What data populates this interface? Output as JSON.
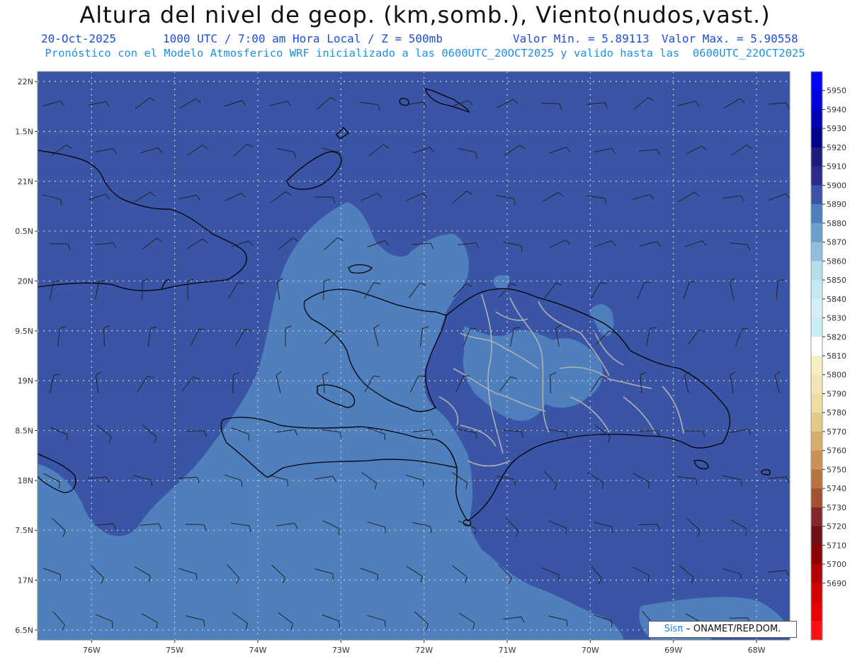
{
  "title": "Altura del nivel de geop. (km,somb.), Viento(nudos,vast.)",
  "subtitle": {
    "date": "20-Oct-2025",
    "time": "1000 UTC / 7:00 am Hora Local / Z = 500mb",
    "min": "Valor Min. = 5.89113",
    "max": "Valor Max. = 5.90558"
  },
  "forecast_note": "Pronóstico con el Modelo Atmosferico WRF inicializado a las 0600UTC_20OCT2025 y valido hasta las  0600UTC_22OCT2025",
  "credit": {
    "brand": "Sisπ",
    "text": " – ONAMET/REP.DOM."
  },
  "chart_data": {
    "type": "heatmap",
    "variable": "500mb geopotential height (m) with wind barbs (knots)",
    "lat_labels": [
      "22N",
      "1.5N",
      "21N",
      "0.5N",
      "20N",
      "9.5N",
      "19N",
      "8.5N",
      "18N",
      "7.5N",
      "17N",
      "6.5N"
    ],
    "lat_values": [
      22,
      21.5,
      21,
      20.5,
      20,
      19.5,
      19,
      18.5,
      18,
      17.5,
      17,
      16.5
    ],
    "lon_labels": [
      "76W",
      "75W",
      "74W",
      "73W",
      "72W",
      "71W",
      "70W",
      "69W",
      "68W"
    ],
    "lon_values": [
      -76,
      -75,
      -74,
      -73,
      -72,
      -71,
      -70,
      -69,
      -68
    ],
    "xlim": [
      -76.65,
      -67.6
    ],
    "ylim": [
      16.4,
      22.1
    ],
    "value_range": [
      5891.13,
      5905.58
    ],
    "grid": true,
    "colorbar": {
      "labels": [
        5950,
        5940,
        5930,
        5920,
        5910,
        5900,
        5890,
        5880,
        5870,
        5860,
        5850,
        5840,
        5830,
        5820,
        5810,
        5800,
        5790,
        5780,
        5770,
        5760,
        5750,
        5740,
        5730,
        5720,
        5710,
        5700,
        5690
      ],
      "colors": [
        "#0000ff",
        "#0000dd",
        "#0000b4",
        "#00008b",
        "#1c1c7c",
        "#2a2a8c",
        "#3a55a6",
        "#4f80bd",
        "#6b9fcc",
        "#92bedd",
        "#b4dcea",
        "#c6e8f0",
        "#d4eef7",
        "#c8eef5",
        "#ffffff",
        "#f6efc4",
        "#f2e6b6",
        "#eedca2",
        "#e4c98a",
        "#d6ad6f",
        "#c99358",
        "#b97444",
        "#a25233",
        "#85272a",
        "#6e0f16",
        "#8b0000",
        "#b30000",
        "#d40000",
        "#e80000",
        "#ff1010"
      ]
    },
    "fields": [
      {
        "level": "5900-5910",
        "color": "#3a55a6",
        "region": "north Atlantic, Cuba, eastern Hispaniola, Caribbean southeast"
      },
      {
        "level": "5890-5900",
        "color": "#4f80bd",
        "region": "Windward Passage, Haiti, southwest Caribbean"
      }
    ]
  },
  "colors": {
    "field_high": "#3a55a6",
    "field_low": "#4f80bd",
    "barb": "#222222",
    "coast": "#000000",
    "provinces": "#b0b0b0",
    "title_line1": "#1a4fd8",
    "title_line2": "#1e90e0"
  }
}
